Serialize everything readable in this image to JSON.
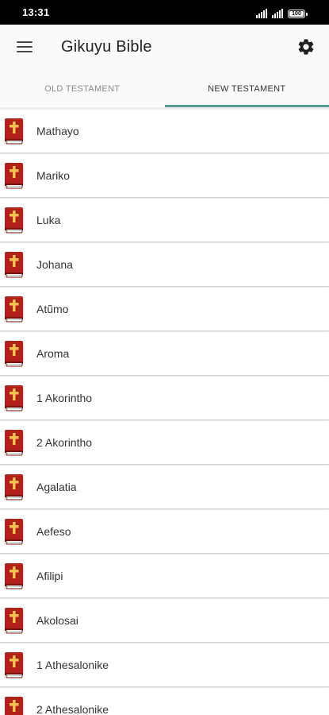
{
  "status_bar": {
    "time": "13:31",
    "battery": "100"
  },
  "app_bar": {
    "title": "Gikuyu Bible",
    "menu_icon": "hamburger-menu-icon",
    "settings_icon": "gear-icon"
  },
  "tabs": [
    {
      "label": "OLD TESTAMENT",
      "selected": false
    },
    {
      "label": "NEW TESTAMENT",
      "selected": true
    }
  ],
  "colors": {
    "tab_indicator": "#5a9c92",
    "book_icon": "#b3201c",
    "cross": "#f2c14e"
  },
  "books": [
    {
      "name": "Mathayo"
    },
    {
      "name": "Mariko"
    },
    {
      "name": "Luka"
    },
    {
      "name": "Johana"
    },
    {
      "name": "Atũmo"
    },
    {
      "name": "Aroma"
    },
    {
      "name": "1 Akorintho"
    },
    {
      "name": "2 Akorintho"
    },
    {
      "name": "Agalatia"
    },
    {
      "name": "Aefeso"
    },
    {
      "name": "Afilipi"
    },
    {
      "name": "Akolosai"
    },
    {
      "name": "1 Athesalonike"
    },
    {
      "name": "2 Athesalonike"
    }
  ]
}
